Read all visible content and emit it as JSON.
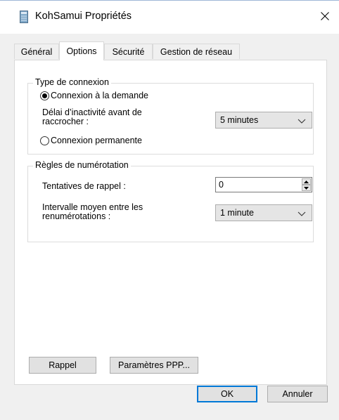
{
  "window": {
    "title": "KohSamui Propriétés",
    "close_icon": "close-icon",
    "app_icon": "phonebook-icon"
  },
  "tabs": [
    {
      "label": "Général",
      "active": false
    },
    {
      "label": "Options",
      "active": true
    },
    {
      "label": "Sécurité",
      "active": false
    },
    {
      "label": "Gestion de réseau",
      "active": false
    }
  ],
  "connection_type": {
    "legend": "Type de connexion",
    "on_demand_label": "Connexion à la demande",
    "on_demand_selected": true,
    "idle_label": "Délai d’inactivité avant de raccrocher :",
    "idle_value": "5 minutes",
    "permanent_label": "Connexion permanente",
    "permanent_selected": false
  },
  "redial_rules": {
    "legend": "Règles de numérotation",
    "attempts_label": "Tentatives de rappel :",
    "attempts_value": "0",
    "interval_label": "Intervalle moyen entre les renumérotations :",
    "interval_value": "1 minute"
  },
  "panel_buttons": {
    "callback_label": "Rappel",
    "ppp_label": "Paramètres PPP..."
  },
  "dialog_buttons": {
    "ok_label": "OK",
    "cancel_label": "Annuler"
  },
  "colors": {
    "focus_border": "#0078d7",
    "dialog_background": "#f0f0f0"
  }
}
